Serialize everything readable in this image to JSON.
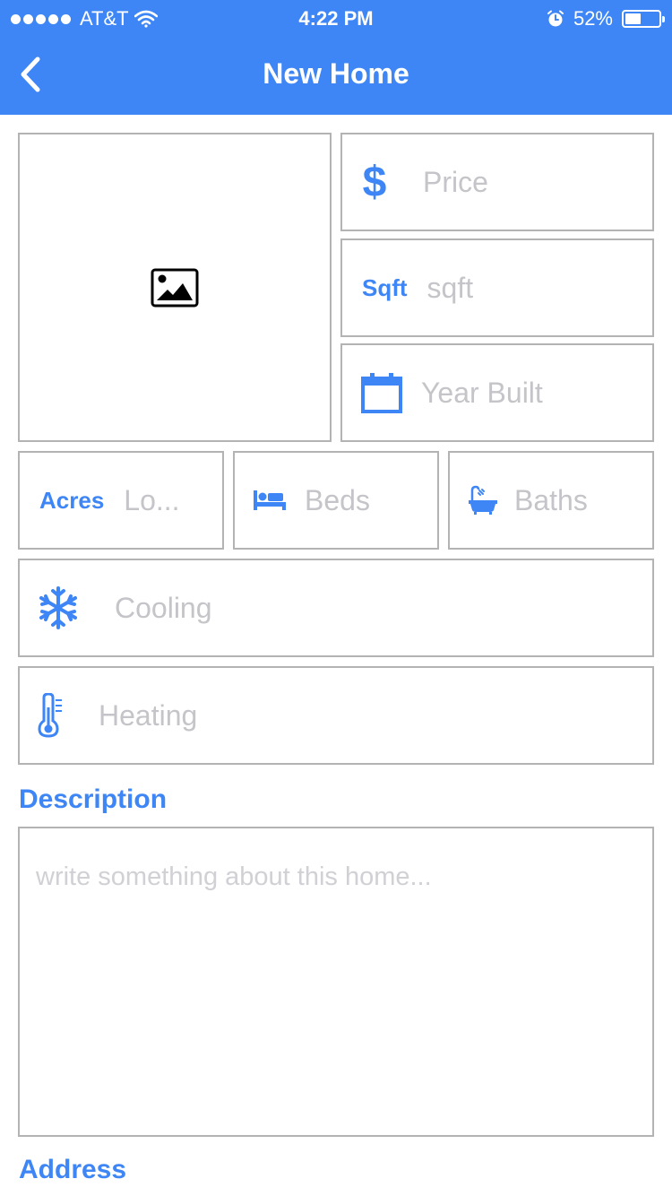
{
  "status_bar": {
    "carrier": "AT&T",
    "time": "4:22 PM",
    "battery": "52%",
    "battery_level": 0.52
  },
  "nav": {
    "title": "New Home"
  },
  "fields": {
    "price_placeholder": "Price",
    "sqft_label": "Sqft",
    "sqft_placeholder": "sqft",
    "year_built_placeholder": "Year Built",
    "acres_label": "Acres",
    "acres_placeholder": "Lo...",
    "beds_placeholder": "Beds",
    "baths_placeholder": "Baths",
    "cooling_placeholder": "Cooling",
    "heating_placeholder": "Heating"
  },
  "description": {
    "title": "Description",
    "placeholder": "write something about this home..."
  },
  "address": {
    "title": "Address"
  },
  "icons": {
    "back": "chevron-left-icon",
    "photo": "image-icon",
    "price": "dollar-icon",
    "year": "calendar-icon",
    "beds": "bed-icon",
    "baths": "bathtub-icon",
    "cooling": "snowflake-icon",
    "heating": "thermometer-icon"
  },
  "colors": {
    "accent": "#3e86f5",
    "border": "#b3b3b3",
    "placeholder": "#c4c4c9"
  }
}
